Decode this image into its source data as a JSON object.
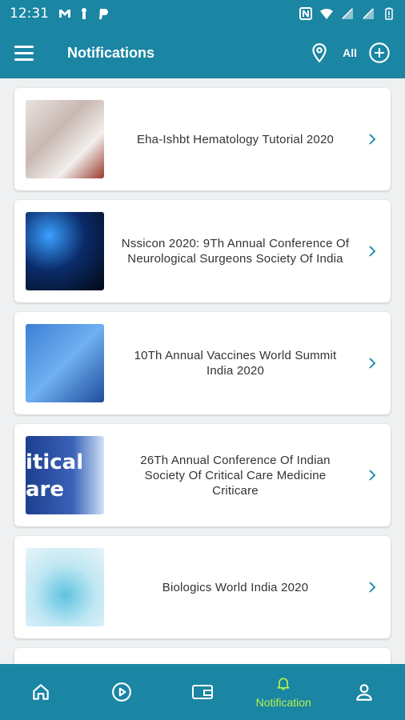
{
  "status_bar": {
    "time": "12:31"
  },
  "app_bar": {
    "title": "Notifications",
    "filter_label": "All"
  },
  "notifications": [
    {
      "title": "Eha-Ishbt Hematology Tutorial 2020"
    },
    {
      "title": "Nssicon 2020: 9Th Annual Conference Of Neurological Surgeons Society Of India"
    },
    {
      "title": "10Th Annual Vaccines World Summit India 2020"
    },
    {
      "title": "26Th Annual Conference Of Indian Society Of Critical Care Medicine Criticare",
      "thumb_text": "itical\nare"
    },
    {
      "title": "Biologics World India 2020"
    }
  ],
  "bottom_nav": {
    "active_label": "Notification"
  },
  "colors": {
    "primary": "#1a86a3",
    "active": "#b7f04e",
    "chevron": "#1a86a3"
  }
}
